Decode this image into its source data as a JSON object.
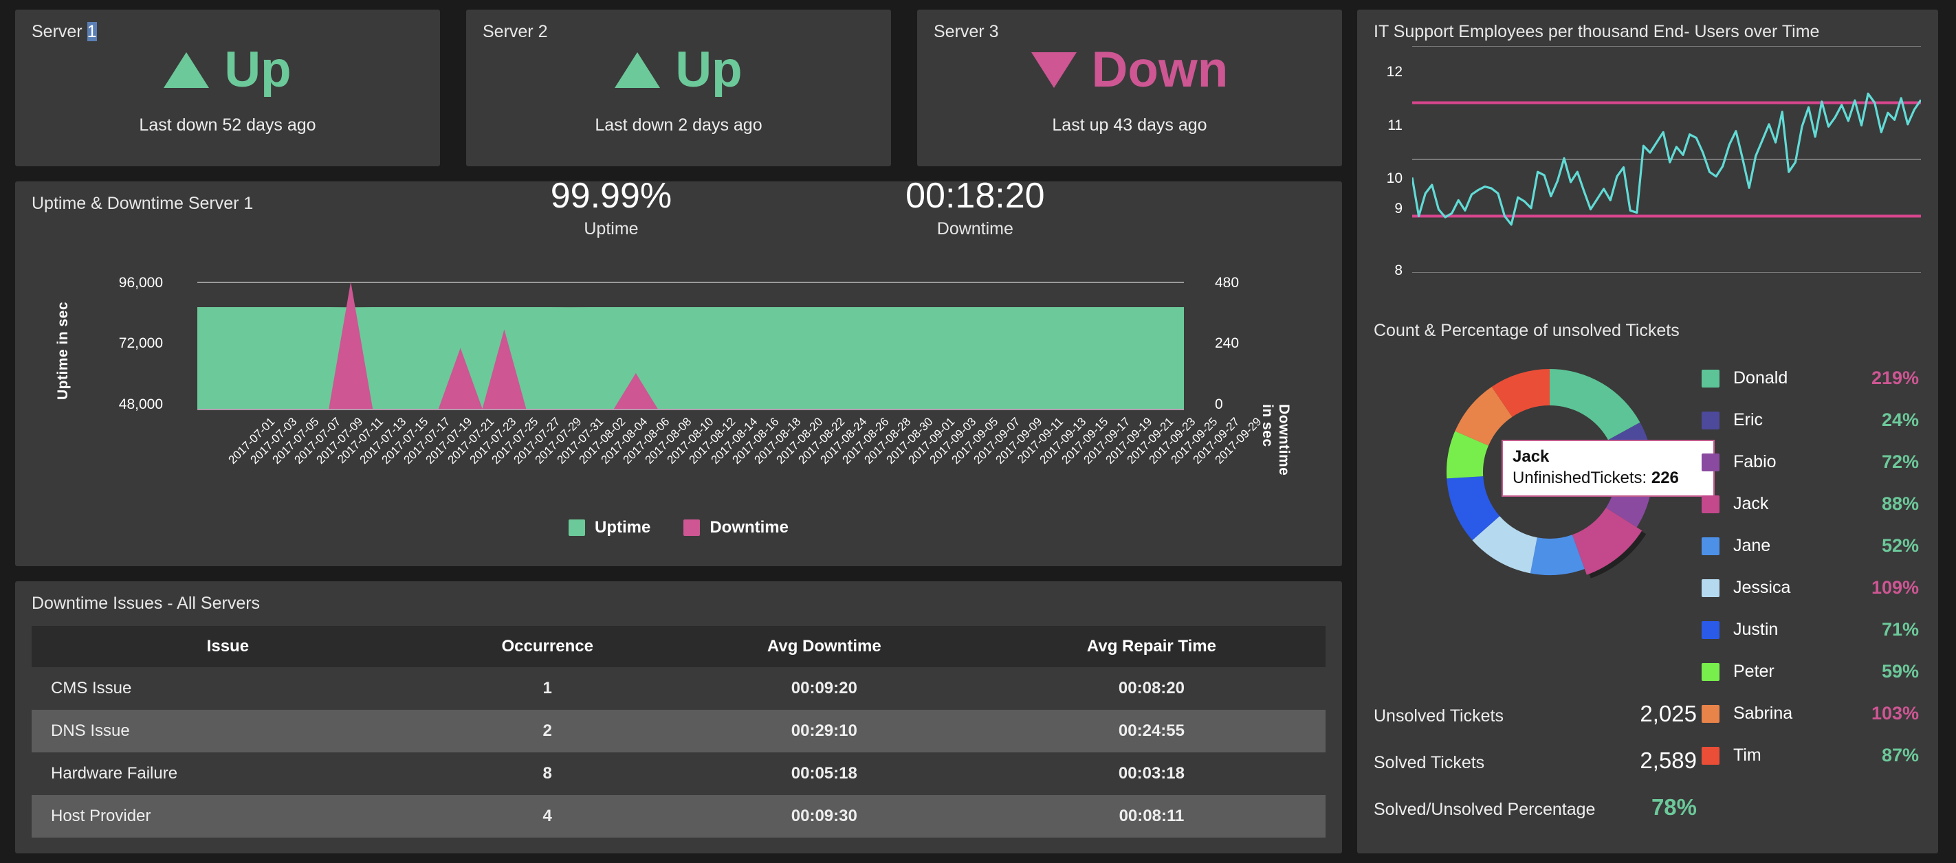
{
  "colors": {
    "up_green": "#6cc99a",
    "down_pink": "#cd5693",
    "page_bg": "#1b1b1b",
    "panel_bg": "#3a3a3a",
    "line_cyan": "#61dbd6",
    "ref_line_pink": "#d8468f"
  },
  "servers": [
    {
      "title": "Server 1",
      "title_pre": "Server ",
      "title_sel": "1",
      "status": "Up",
      "icon": "triangle-up-icon",
      "sub": "Last down 52 days ago"
    },
    {
      "title": "Server 2",
      "title_pre": "Server 2",
      "title_sel": "",
      "status": "Up",
      "icon": "triangle-up-icon",
      "sub": "Last down 2 days ago"
    },
    {
      "title": "Server 3",
      "title_pre": "Server 3",
      "title_sel": "",
      "status": "Down",
      "icon": "triangle-down-icon",
      "sub": "Last up 43 days ago"
    }
  ],
  "uptime_panel": {
    "title": "Uptime & Downtime Server 1",
    "uptime_value": "99.99%",
    "uptime_label": "Uptime",
    "downtime_value": "00:18:20",
    "downtime_label": "Downtime",
    "y_axis_title": "Uptime in sec",
    "y2_axis_title": "Downtime in sec",
    "legend": [
      {
        "label": "Uptime",
        "color": "#6cc99a"
      },
      {
        "label": "Downtime",
        "color": "#cd5693"
      }
    ]
  },
  "table_panel": {
    "title": "Downtime Issues - All Servers",
    "columns": [
      "Issue",
      "Occurrence",
      "Avg Downtime",
      "Avg Repair Time"
    ],
    "rows": [
      {
        "issue": "CMS Issue",
        "occurrence": "1",
        "avg_downtime": "00:09:20",
        "avg_repair": "00:08:20"
      },
      {
        "issue": "DNS Issue",
        "occurrence": "2",
        "avg_downtime": "00:29:10",
        "avg_repair": "00:24:55"
      },
      {
        "issue": "Hardware Failure",
        "occurrence": "8",
        "avg_downtime": "00:05:18",
        "avg_repair": "00:03:18"
      },
      {
        "issue": "Host Provider",
        "occurrence": "4",
        "avg_downtime": "00:09:30",
        "avg_repair": "00:08:11"
      }
    ]
  },
  "right_panel": {
    "line_title": "IT Support Employees per thousand End- Users over Time",
    "donut_title": "Count & Percentage of unsolved Tickets",
    "tooltip": {
      "name": "Jack",
      "metric_label": "UnfinishedTickets:",
      "metric_value": "226"
    },
    "legend": [
      {
        "name": "Donald",
        "pct": "219%",
        "color": "#5cc496",
        "over": true
      },
      {
        "name": "Eric",
        "pct": "24%",
        "color": "#4d4a9c",
        "over": false
      },
      {
        "name": "Fabio",
        "pct": "72%",
        "color": "#8a4aa0",
        "over": false
      },
      {
        "name": "Jack",
        "pct": "88%",
        "color": "#c4488c",
        "over": false
      },
      {
        "name": "Jane",
        "pct": "52%",
        "color": "#4d90e8",
        "over": false
      },
      {
        "name": "Jessica",
        "pct": "109%",
        "color": "#b5d9ef",
        "over": true
      },
      {
        "name": "Justin",
        "pct": "71%",
        "color": "#2a5ae8",
        "over": false
      },
      {
        "name": "Peter",
        "pct": "59%",
        "color": "#78ee4c",
        "over": false
      },
      {
        "name": "Sabrina",
        "pct": "103%",
        "color": "#e8834a",
        "over": true
      },
      {
        "name": "Tim",
        "pct": "87%",
        "color": "#ea4e37",
        "over": false
      }
    ],
    "summary": [
      {
        "label": "Unsolved Tickets",
        "value": "2,025",
        "accent": false
      },
      {
        "label": "Solved Tickets",
        "value": "2,589",
        "accent": false
      },
      {
        "label": "Solved/Unsolved Percentage",
        "value": "78%",
        "accent": true
      }
    ]
  },
  "chart_data": [
    {
      "type": "area",
      "title": "Uptime & Downtime Server 1",
      "xlabel": "",
      "ylabel": "Uptime in sec",
      "y2label": "Downtime in sec",
      "ylim": [
        48000,
        96000
      ],
      "yticks": [
        "96,000",
        "72,000",
        "48,000"
      ],
      "y2lim": [
        0,
        480
      ],
      "y2ticks": [
        "480",
        "240",
        "0"
      ],
      "grid": true,
      "legend_position": "bottom-center",
      "categories": [
        "2017-07-01",
        "2017-07-03",
        "2017-07-05",
        "2017-07-07",
        "2017-07-09",
        "2017-07-11",
        "2017-07-13",
        "2017-07-15",
        "2017-07-17",
        "2017-07-19",
        "2017-07-21",
        "2017-07-23",
        "2017-07-25",
        "2017-07-27",
        "2017-07-29",
        "2017-07-31",
        "2017-08-02",
        "2017-08-04",
        "2017-08-06",
        "2017-08-08",
        "2017-08-10",
        "2017-08-12",
        "2017-08-14",
        "2017-08-16",
        "2017-08-18",
        "2017-08-20",
        "2017-08-22",
        "2017-08-24",
        "2017-08-26",
        "2017-08-28",
        "2017-08-30",
        "2017-09-01",
        "2017-09-03",
        "2017-09-05",
        "2017-09-07",
        "2017-09-09",
        "2017-09-11",
        "2017-09-13",
        "2017-09-15",
        "2017-09-17",
        "2017-09-19",
        "2017-09-21",
        "2017-09-23",
        "2017-09-25",
        "2017-09-27",
        "2017-09-29"
      ],
      "series": [
        {
          "name": "Uptime",
          "color": "#6cc99a",
          "values": [
            86400,
            86400,
            86400,
            86400,
            86400,
            86400,
            86400,
            86350,
            86400,
            86400,
            86400,
            86400,
            86400,
            86400,
            86400,
            86400,
            86400,
            86380,
            86400,
            86400,
            86400,
            86400,
            86400,
            86400,
            86400,
            86400,
            86400,
            86400,
            86400,
            86400,
            86400,
            86400,
            86400,
            86400,
            86400,
            86400,
            86400,
            86400,
            86400,
            86400,
            86400,
            86400,
            86400,
            86400,
            86400,
            86400
          ]
        },
        {
          "name": "Downtime",
          "color": "#cd5693",
          "values": [
            0,
            0,
            0,
            0,
            0,
            0,
            0,
            480,
            0,
            0,
            0,
            0,
            230,
            0,
            300,
            0,
            0,
            0,
            0,
            0,
            135,
            0,
            0,
            0,
            0,
            0,
            0,
            0,
            0,
            0,
            0,
            0,
            0,
            0,
            0,
            0,
            0,
            0,
            0,
            0,
            0,
            0,
            0,
            0,
            0,
            0
          ]
        }
      ]
    },
    {
      "type": "line",
      "title": "IT Support Employees per thousand End- Users over Time",
      "xlabel": "",
      "ylabel": "",
      "ylim": [
        8,
        12
      ],
      "yticks": [
        "12",
        "11",
        "10",
        "9",
        "8"
      ],
      "grid": true,
      "legend_position": "none",
      "reference_lines": [
        {
          "value": 11,
          "color": "#d8468f"
        },
        {
          "value": 9,
          "color": "#d8468f"
        }
      ],
      "series": [
        {
          "name": "IT Support Employees per thousand End-Users",
          "color": "#61dbd6",
          "values": [
            9.68,
            9.0,
            9.4,
            9.55,
            9.12,
            8.98,
            9.05,
            9.28,
            9.1,
            9.38,
            9.46,
            9.52,
            9.49,
            9.4,
            9.0,
            8.85,
            9.33,
            9.26,
            9.14,
            9.78,
            9.72,
            9.35,
            9.62,
            10.02,
            9.6,
            9.78,
            9.44,
            9.12,
            9.3,
            9.48,
            9.28,
            9.7,
            9.86,
            9.1,
            9.06,
            10.24,
            10.12,
            10.3,
            10.48,
            9.95,
            10.22,
            10.08,
            10.44,
            10.38,
            10.12,
            9.78,
            9.7,
            9.88,
            10.26,
            10.5,
            10.02,
            9.5,
            10.06,
            10.34,
            10.62,
            10.3,
            10.84,
            9.78,
            9.95,
            10.58,
            10.92,
            10.4,
            11.02,
            10.58,
            10.74,
            10.96,
            10.68,
            11.04,
            10.6,
            11.16,
            11.0,
            10.48,
            10.82,
            10.7,
            11.08,
            10.62,
            10.88,
            11.05
          ]
        }
      ]
    },
    {
      "type": "pie",
      "title": "Count & Percentage of unsolved Tickets",
      "donut": true,
      "legend_position": "right",
      "labels": [
        "Donald",
        "Eric",
        "Fabio",
        "Jack",
        "Jane",
        "Jessica",
        "Justin",
        "Peter",
        "Sabrina",
        "Tim"
      ],
      "colors": [
        "#5cc496",
        "#4d4a9c",
        "#8a4aa0",
        "#c4488c",
        "#4d90e8",
        "#b5d9ef",
        "#2a5ae8",
        "#78ee4c",
        "#e8834a",
        "#ea4e37"
      ],
      "percentages": [
        219,
        24,
        72,
        88,
        52,
        109,
        71,
        59,
        103,
        87
      ],
      "slice_shares": [
        17.0,
        7.5,
        9.5,
        10.5,
        8.5,
        10.5,
        10.5,
        7.5,
        9.0,
        9.5
      ],
      "highlighted": "Jack",
      "highlighted_value": 226
    }
  ]
}
